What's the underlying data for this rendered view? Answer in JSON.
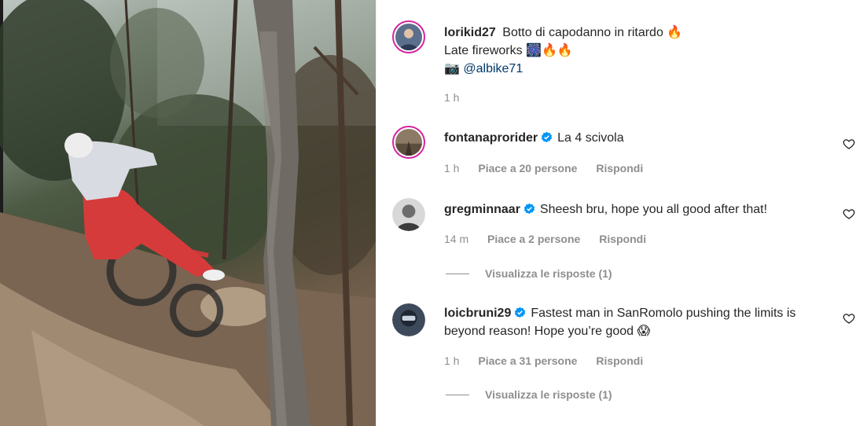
{
  "caption": {
    "username": "lorikid27",
    "line1": "Botto di capodanno in ritardo",
    "line1_emoji": "🔥",
    "line2": "Late fireworks",
    "line2_emoji": "🎆🔥🔥",
    "camera_emoji": "📷",
    "mention": "@albike71",
    "time": "1 h"
  },
  "comments": [
    {
      "username": "fontanaprorider",
      "verified": true,
      "text": "La 4 scivola",
      "time": "1 h",
      "likes": "Piace a 20 persone",
      "reply": "Rispondi"
    },
    {
      "username": "gregminnaar",
      "verified": true,
      "text": "Sheesh bru, hope you all good after that!",
      "time": "14 m",
      "likes": "Piace a 2 persone",
      "reply": "Rispondi",
      "view_replies": "Visualizza le risposte (1)"
    },
    {
      "username": "loicbruni29",
      "verified": true,
      "text_line1": "Fastest man in SanRomolo pushing the limits is",
      "text_line2": "beyond reason! Hope you’re good",
      "text_emoji": "😱",
      "time": "1 h",
      "likes": "Piace a 31 persone",
      "reply": "Rispondi",
      "view_replies": "Visualizza le risposte (1)"
    }
  ],
  "colors": {
    "verified_blue": "#0095f6",
    "story_ring": "#d6249f",
    "meta_gray": "#8e8e8e",
    "text": "#262626"
  },
  "icons": {
    "like": "heart-outline-icon",
    "verified": "verified-badge-icon"
  }
}
